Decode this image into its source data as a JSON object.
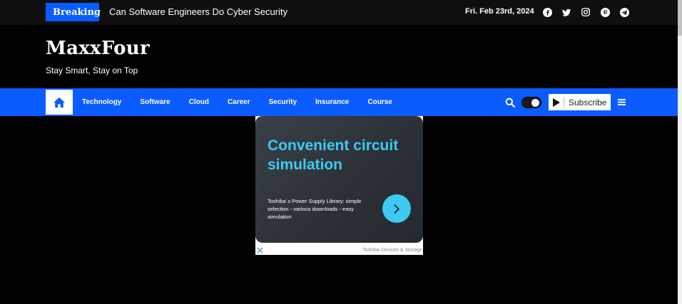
{
  "topbar": {
    "breaking_label": "Breaking",
    "headline": "Can Software Engineers Do Cyber Security",
    "date": "Fri. Feb 23rd, 2024",
    "socials": [
      "facebook-icon",
      "twitter-icon",
      "instagram-icon",
      "pinterest-icon",
      "telegram-icon"
    ]
  },
  "brand": {
    "name": "MaxxFour",
    "tagline": "Stay Smart, Stay on Top"
  },
  "nav": {
    "items": [
      {
        "label": "Technology"
      },
      {
        "label": "Software"
      },
      {
        "label": "Cloud"
      },
      {
        "label": "Career"
      },
      {
        "label": "Security"
      },
      {
        "label": "Insurance"
      },
      {
        "label": "Course"
      }
    ],
    "subscribe_label": "Subscribe"
  },
  "ad": {
    "title": "Convenient circuit simulation",
    "description": "Toshiba´s Power Supply Library: simple selection - various downloads - easy simulation",
    "sponsor": "Toshiba Devices & Storage"
  },
  "colors": {
    "accent": "#0a5cff",
    "ad_title": "#3ccaf2",
    "background": "#000000"
  }
}
